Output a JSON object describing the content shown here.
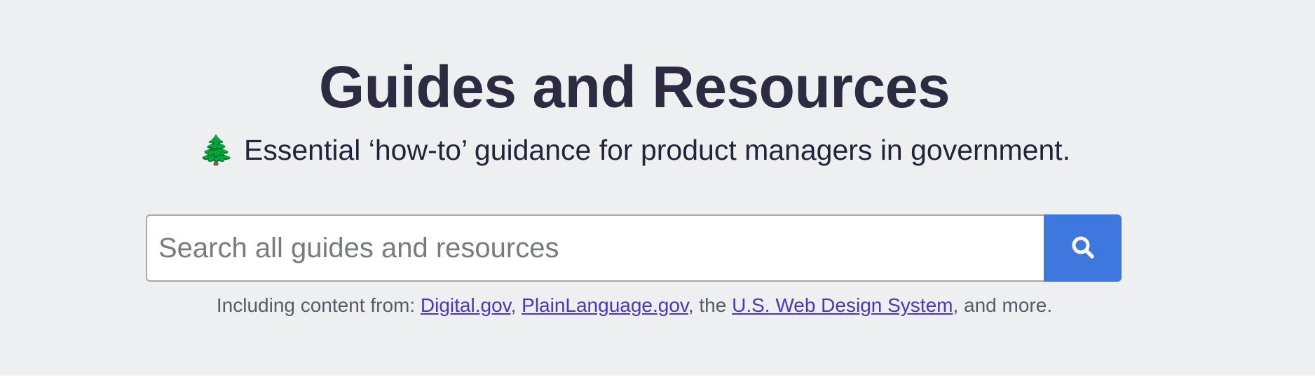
{
  "hero": {
    "title": "Guides and Resources",
    "subtitle_emoji": "🌲",
    "subtitle_text": "Essential ‘how-to’ guidance for product managers in government."
  },
  "search": {
    "placeholder": "Search all guides and resources",
    "value": "",
    "button_icon": "search-icon",
    "button_color": "#3e77de"
  },
  "sources": {
    "prefix": "Including content from: ",
    "links": [
      "Digital.gov",
      "PlainLanguage.gov",
      "U.S. Web Design System"
    ],
    "sep_1": ", ",
    "sep_2": ", the ",
    "suffix": ", and more."
  },
  "colors": {
    "background": "#eeeff1",
    "title": "#2c2b41",
    "link": "#4b35c4",
    "muted_text": "#565c65"
  }
}
